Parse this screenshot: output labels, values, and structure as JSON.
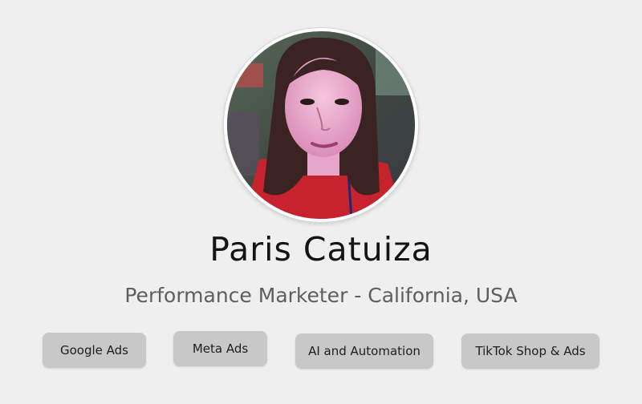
{
  "profile": {
    "name": "Paris Catuiza",
    "title": "Performance Marketer - California, USA"
  },
  "tags": [
    {
      "label": "Google Ads"
    },
    {
      "label": "Meta Ads"
    },
    {
      "label": "AI and Automation"
    },
    {
      "label": "TikTok Shop & Ads"
    }
  ],
  "colors": {
    "background": "#efefef",
    "tag_background": "#c8c8c8",
    "name_text": "#141414",
    "subtitle_text": "#5e5e5e"
  }
}
